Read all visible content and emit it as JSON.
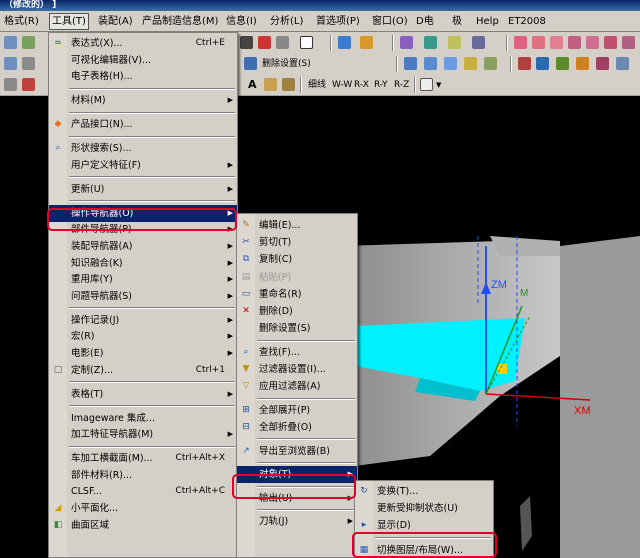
{
  "window": {
    "title": "（修改的） ]"
  },
  "menubar": [
    "格式(R)",
    "工具(T)",
    "装配(A)",
    "产品制造信息(M)",
    "信息(I)",
    "分析(L)",
    "首选项(P)",
    "窗口(O)",
    "D电",
    "极",
    "Help",
    "ET2008"
  ],
  "toolbar": {
    "delete_settings": "删除设置(S)",
    "text_items": [
      "细线",
      "W-W",
      "R-X",
      "R-Y",
      "R-Z"
    ]
  },
  "tools_menu": [
    {
      "label": "表达式(X)...",
      "shortcut": "Ctrl+E",
      "icon": "expression-icon"
    },
    {
      "label": "可视化编辑器(V)..."
    },
    {
      "label": "电子表格(H)..."
    },
    {
      "sep": true
    },
    {
      "label": "材料(M)",
      "submenu": true
    },
    {
      "sep": true
    },
    {
      "label": "产品接口(N)...",
      "icon": "product-interface-icon"
    },
    {
      "sep": true
    },
    {
      "label": "形状搜索(S)...",
      "icon": "shape-search-icon"
    },
    {
      "label": "用户定义特征(F)",
      "submenu": true
    },
    {
      "sep": true
    },
    {
      "label": "更新(U)",
      "submenu": true
    },
    {
      "sep": true
    },
    {
      "label": "操作导航器(O)",
      "submenu": true,
      "highlight": true
    },
    {
      "label": "部件导航器(P)",
      "submenu": true
    },
    {
      "label": "装配导航器(A)",
      "submenu": true
    },
    {
      "label": "知识融合(K)",
      "submenu": true
    },
    {
      "label": "重用库(Y)",
      "submenu": true
    },
    {
      "label": "问题导航器(S)",
      "submenu": true
    },
    {
      "sep": true
    },
    {
      "label": "操作记录(J)",
      "submenu": true
    },
    {
      "label": "宏(R)",
      "submenu": true
    },
    {
      "label": "电影(E)",
      "submenu": true
    },
    {
      "label": "定制(Z)...",
      "shortcut": "Ctrl+1",
      "icon": "customize-icon"
    },
    {
      "sep": true
    },
    {
      "label": "表格(T)",
      "submenu": true
    },
    {
      "sep": true
    },
    {
      "label": "Imageware 集成..."
    },
    {
      "label": "加工特征导航器(M)",
      "submenu": true
    },
    {
      "sep": true
    },
    {
      "label": "车加工横截面(M)...",
      "shortcut": "Ctrl+Alt+X"
    },
    {
      "label": "部件材料(R)..."
    },
    {
      "label": "CLSF...",
      "shortcut": "Ctrl+Alt+C"
    },
    {
      "label": "小平面化...",
      "icon": "facet-icon"
    },
    {
      "label": "曲面区域",
      "icon": "surface-region-icon"
    }
  ],
  "op_nav_menu": [
    {
      "label": "编辑(E)...",
      "icon": "edit-icon"
    },
    {
      "label": "剪切(T)",
      "icon": "cut-icon"
    },
    {
      "label": "复制(C)",
      "icon": "copy-icon"
    },
    {
      "label": "粘贴(P)",
      "icon": "paste-icon",
      "disabled": true
    },
    {
      "label": "重命名(R)",
      "icon": "rename-icon"
    },
    {
      "label": "删除(D)",
      "icon": "delete-icon"
    },
    {
      "label": "删除设置(S)"
    },
    {
      "sep": true
    },
    {
      "label": "查找(F)...",
      "icon": "find-icon"
    },
    {
      "label": "过滤器设置(I)...",
      "icon": "filter-settings-icon"
    },
    {
      "label": "应用过滤器(A)",
      "icon": "apply-filter-icon"
    },
    {
      "sep": true
    },
    {
      "label": "全部展开(P)",
      "icon": "expand-all-icon"
    },
    {
      "label": "全部折叠(O)",
      "icon": "collapse-all-icon"
    },
    {
      "sep": true
    },
    {
      "label": "导出至浏览器(B)",
      "icon": "export-browser-icon"
    },
    {
      "sep": true
    },
    {
      "label": "对象(T)",
      "submenu": true,
      "highlight": true
    },
    {
      "sep": true
    },
    {
      "label": "输出(U)",
      "submenu": true
    },
    {
      "sep": true
    },
    {
      "label": "刀轨(J)",
      "submenu": true
    }
  ],
  "object_menu": [
    {
      "label": "变换(T)...",
      "icon": "transform-icon"
    },
    {
      "label": "更新受抑制状态(U)"
    },
    {
      "label": "显示(D)",
      "icon": "display-icon"
    },
    {
      "sep": true
    },
    {
      "label": "切换图层/布局(W)...",
      "icon": "layer-layout-icon"
    }
  ],
  "viewport": {
    "axis_zm": "ZM",
    "axis_xm": "XM",
    "axis_m": "M"
  },
  "colors": {
    "highlight": "#0a246a",
    "menu_bg": "#d4d0c8",
    "annotation_red": "#e0002a",
    "model_cyan": "#00f0ff"
  }
}
